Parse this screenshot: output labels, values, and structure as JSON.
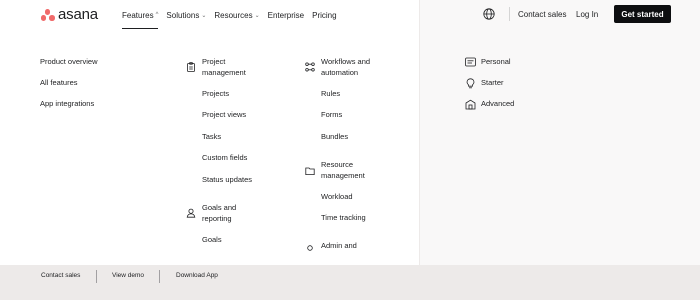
{
  "brand": {
    "name": "asana",
    "color": "#f06a6a"
  },
  "nav": {
    "features": "Features",
    "solutions": "Solutions",
    "resources": "Resources",
    "enterprise": "Enterprise",
    "pricing": "Pricing",
    "chevron_up": "^",
    "chevron_down": "⌄"
  },
  "header_right": {
    "contact_sales": "Contact sales",
    "log_in": "Log In",
    "get_started": "Get started"
  },
  "overview_links": [
    "Product overview",
    "All features",
    "App integrations"
  ],
  "project_management": {
    "heading": [
      "Project",
      "management"
    ],
    "items": [
      "Projects",
      "Project views",
      "Tasks",
      "Custom fields",
      "Status updates"
    ]
  },
  "goals_reporting": {
    "heading": [
      "Goals and",
      "reporting"
    ],
    "items": [
      "Goals"
    ]
  },
  "workflows_automation": {
    "heading": [
      "Workflows and",
      "automation"
    ],
    "items": [
      "Rules",
      "Forms",
      "Bundles"
    ]
  },
  "resource_management": {
    "heading": [
      "Resource",
      "management"
    ],
    "items": [
      "Workload",
      "Time tracking"
    ]
  },
  "admin": {
    "heading": "Admin and"
  },
  "plans": [
    "Personal",
    "Starter",
    "Advanced"
  ],
  "footer": [
    "Contact sales",
    "View demo",
    "Download App"
  ]
}
